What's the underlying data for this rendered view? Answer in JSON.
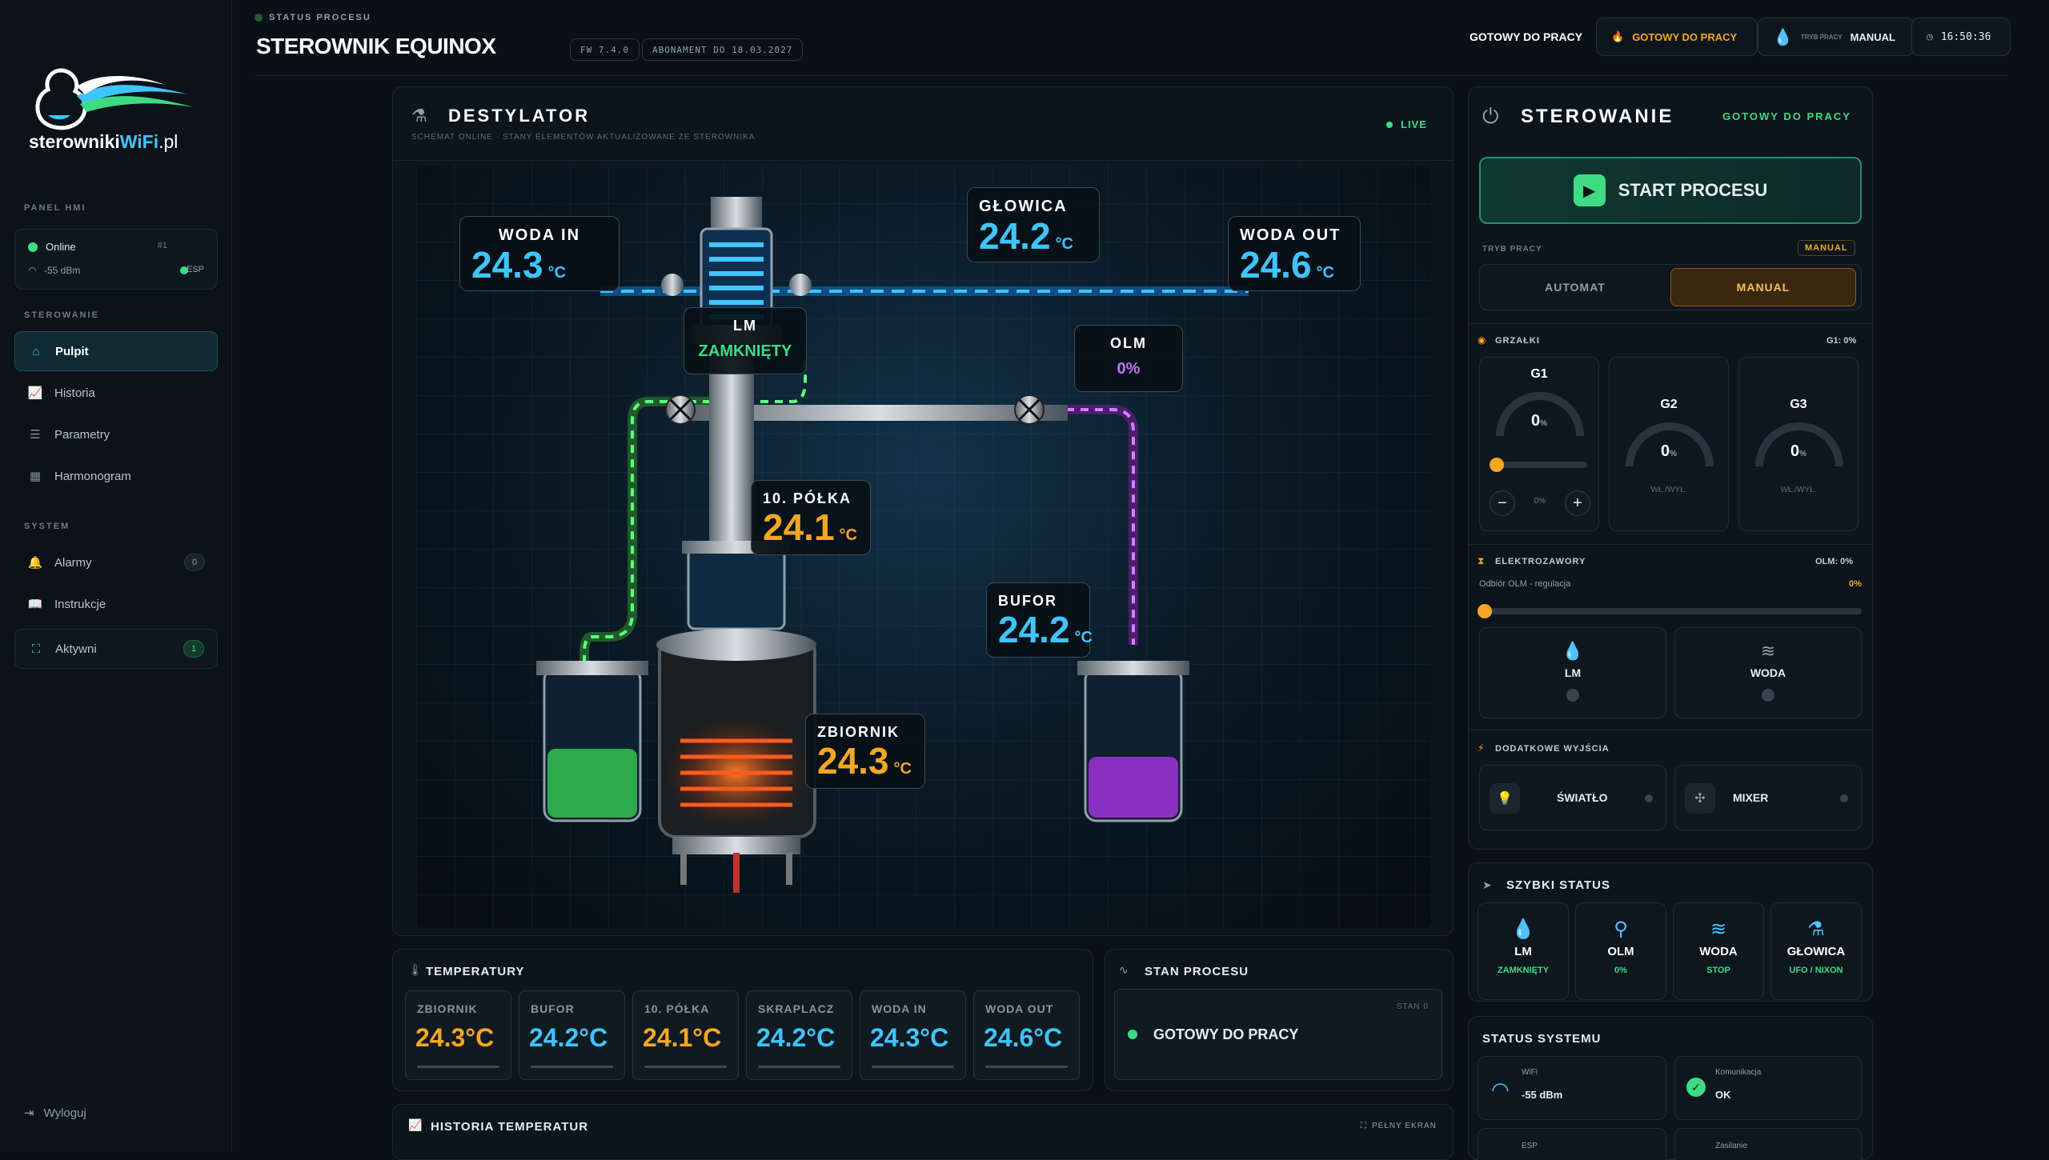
{
  "brand": {
    "logo_part1": "sterowniki",
    "logo_part2": "WiFi",
    "logo_part3": ".pl"
  },
  "sidebar": {
    "panel_label": "PANEL HMI",
    "status": {
      "online": "Online",
      "id": "#1",
      "signal": "-55 dBm",
      "esp": "ESP"
    },
    "section_control": "STEROWANIE",
    "section_system": "SYSTEM",
    "nav": [
      {
        "label": "Pulpit",
        "icon": "home-icon"
      },
      {
        "label": "Historia",
        "icon": "chart-icon"
      },
      {
        "label": "Parametry",
        "icon": "sliders-icon"
      },
      {
        "label": "Harmonogram",
        "icon": "calendar-icon"
      }
    ],
    "system_nav": [
      {
        "label": "Alarmy",
        "badge": "0",
        "icon": "bell-icon"
      },
      {
        "label": "Instrukcje",
        "icon": "book-icon"
      },
      {
        "label": "Aktywni",
        "badge": "1",
        "icon": "users-icon"
      }
    ],
    "logout": "Wyloguj"
  },
  "header": {
    "kicker": "STATUS PROCESU",
    "title": "STEROWNIK EQUINOX",
    "fw": "FW 7.4.0",
    "subscription": "ABONAMENT DO 18.03.2027",
    "ready_text": "GOTOWY DO PRACY",
    "ready_chip": "GOTOWY DO PRACY",
    "mode_label": "TRYB PRACY",
    "mode_value": "MANUAL",
    "time": "16:50:36"
  },
  "destylator": {
    "title": "DESTYLATOR",
    "subtitle": "SCHEMAT ONLINE · STANY ELEMENTÓW AKTUALIZOWANE ZE STEROWNIKA",
    "live": "LIVE",
    "labels": {
      "woda_in": {
        "t": "WODA IN",
        "v": "24.3",
        "u": "°C"
      },
      "glowica": {
        "t": "GŁOWICA",
        "v": "24.2",
        "u": "°C"
      },
      "woda_out": {
        "t": "WODA OUT",
        "v": "24.6",
        "u": "°C"
      },
      "lm": {
        "t": "LM",
        "v": "ZAMKNIĘTY"
      },
      "olm": {
        "t": "OLM",
        "v": "0%"
      },
      "polka": {
        "t": "10. PÓŁKA",
        "v": "24.1",
        "u": "°C"
      },
      "bufor": {
        "t": "BUFOR",
        "v": "24.2",
        "u": "°C"
      },
      "zbiornik": {
        "t": "ZBIORNIK",
        "v": "24.3",
        "u": "°C"
      }
    }
  },
  "temperatury": {
    "title": "TEMPERATURY",
    "cards": [
      {
        "n": "ZBIORNIK",
        "v": "24.3°C",
        "color": "#f5a623"
      },
      {
        "n": "BUFOR",
        "v": "24.2°C",
        "color": "#3fc4ff"
      },
      {
        "n": "10. PÓŁKA",
        "v": "24.1°C",
        "color": "#f5a623"
      },
      {
        "n": "SKRAPLACZ",
        "v": "24.2°C",
        "color": "#3fc4ff"
      },
      {
        "n": "WODA IN",
        "v": "24.3°C",
        "color": "#3fc4ff"
      },
      {
        "n": "WODA OUT",
        "v": "24.6°C",
        "color": "#3fc4ff"
      }
    ]
  },
  "stan": {
    "title": "STAN PROCESU",
    "stage": "STAN 0",
    "value": "GOTOWY DO PRACY"
  },
  "historia": {
    "title": "HISTORIA TEMPERATUR",
    "fullscreen": "PEŁNY EKRAN"
  },
  "sterowanie": {
    "title": "STEROWANIE",
    "status": "GOTOWY DO PRACY",
    "start": "START PROCESU",
    "mode_label": "TRYB PRACY",
    "mode_badge": "MANUAL",
    "auto": "AUTOMAT",
    "manual": "MANUAL",
    "heaters_title": "GRZAŁKI",
    "heaters_summary": "G1: 0%",
    "g1": {
      "name": "G1",
      "value": "0",
      "unit": "%",
      "slider": "0%",
      "level": 0
    },
    "g2": {
      "name": "G2",
      "value": "0",
      "unit": "%",
      "sub": "WŁ./WYŁ."
    },
    "g3": {
      "name": "G3",
      "value": "0",
      "unit": "%",
      "sub": "WŁ./WYŁ."
    },
    "valves_title": "ELEKTROZAWORY",
    "valves_summary": "OLM: 0%",
    "olm_label": "Odbiór OLM - regulacja",
    "olm_value": "0%",
    "olm_level": 0,
    "valve_lm": "LM",
    "valve_woda": "WODA",
    "outputs_title": "DODATKOWE WYJŚCIA",
    "out1": "ŚWIATŁO",
    "out2": "MIXER"
  },
  "szybki": {
    "title": "SZYBKI STATUS",
    "items": [
      {
        "n": "LM",
        "s": "ZAMKNIĘTY",
        "icon": "drop-icon"
      },
      {
        "n": "OLM",
        "s": "0%",
        "icon": "tap-icon"
      },
      {
        "n": "WODA",
        "s": "STOP",
        "icon": "waves-icon"
      },
      {
        "n": "GŁOWICA",
        "s": "UFO / NIXON",
        "icon": "flask-icon"
      }
    ]
  },
  "system": {
    "title": "STATUS SYSTEMU",
    "wifi_label": "WiFi",
    "wifi_value": "-55 dBm",
    "comm_label": "Komunikacja",
    "comm_value": "OK",
    "esp_label": "ESP",
    "power_label": "Zasilanie"
  }
}
